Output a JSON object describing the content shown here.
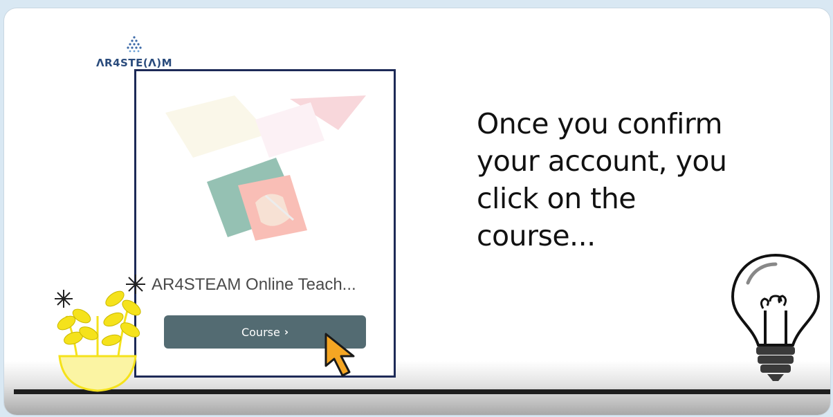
{
  "brand": {
    "logo_text": "ΛR4STE(Λ)M"
  },
  "card": {
    "title": "AR4STEAM Online Teach...",
    "button_label": "Course",
    "button_chevron": "›"
  },
  "caption": {
    "lines": [
      "Once you confirm",
      "your account, you",
      "click on the",
      "course..."
    ]
  },
  "icons": {
    "logo": "dot-triangle-logo-icon",
    "cursor": "arrow-cursor-icon",
    "plant": "potted-plant-icon",
    "flower": "flower-icon",
    "bulb": "lightbulb-icon"
  },
  "colors": {
    "background": "#d9e8f3",
    "card_border": "#1d2a57",
    "button": "#536b72",
    "cursor": "#f5a623",
    "plant": "#f5e21b"
  }
}
